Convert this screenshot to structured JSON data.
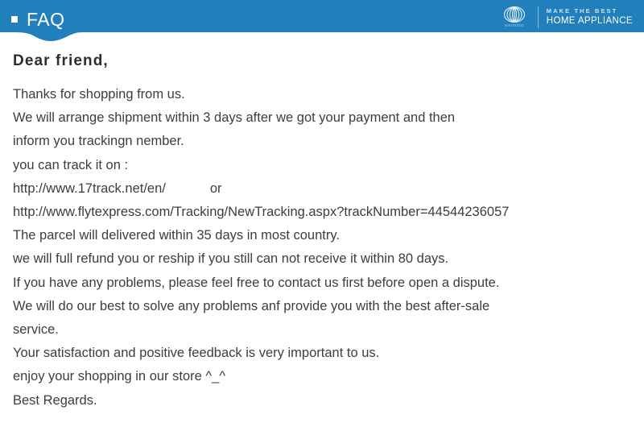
{
  "header": {
    "title": "FAQ",
    "bullet_icon": "square-bullet-icon",
    "background_color": "#2180bc",
    "text_color": "#ffffff"
  },
  "brand": {
    "logo_icon": "concentric-oval-logo-icon",
    "wordmark": "warmtoo",
    "tagline_top": "MAKE THE BEST",
    "tagline_bottom": "HOME APPLIANCE",
    "divider_color": "#8cc0e2"
  },
  "body": {
    "greeting": "Dear friend,",
    "lines": [
      "Thanks for shopping from us.",
      "We will arrange shipment within 3 days after we got your payment and then",
      "inform you trackingn nember.",
      "you can track it on :",
      "http://www.17track.net/en/            or",
      "http://www.flytexpress.com/Tracking/NewTracking.aspx?trackNumber=44544236057",
      "The parcel will delivered within 35 days in most country.",
      "we will full refund you or reship if you still can not receive it within 80 days.",
      "If you have any problems, please feel free to contact us first before open a dispute.",
      "We will do our best to solve any problems anf provide you with the best after-sale",
      "service.",
      "Your satisfaction and positive feedback is very important to us.",
      "enjoy your shopping in our store ^_^",
      "Best Regards."
    ],
    "text_color": "#3d3d3d"
  }
}
